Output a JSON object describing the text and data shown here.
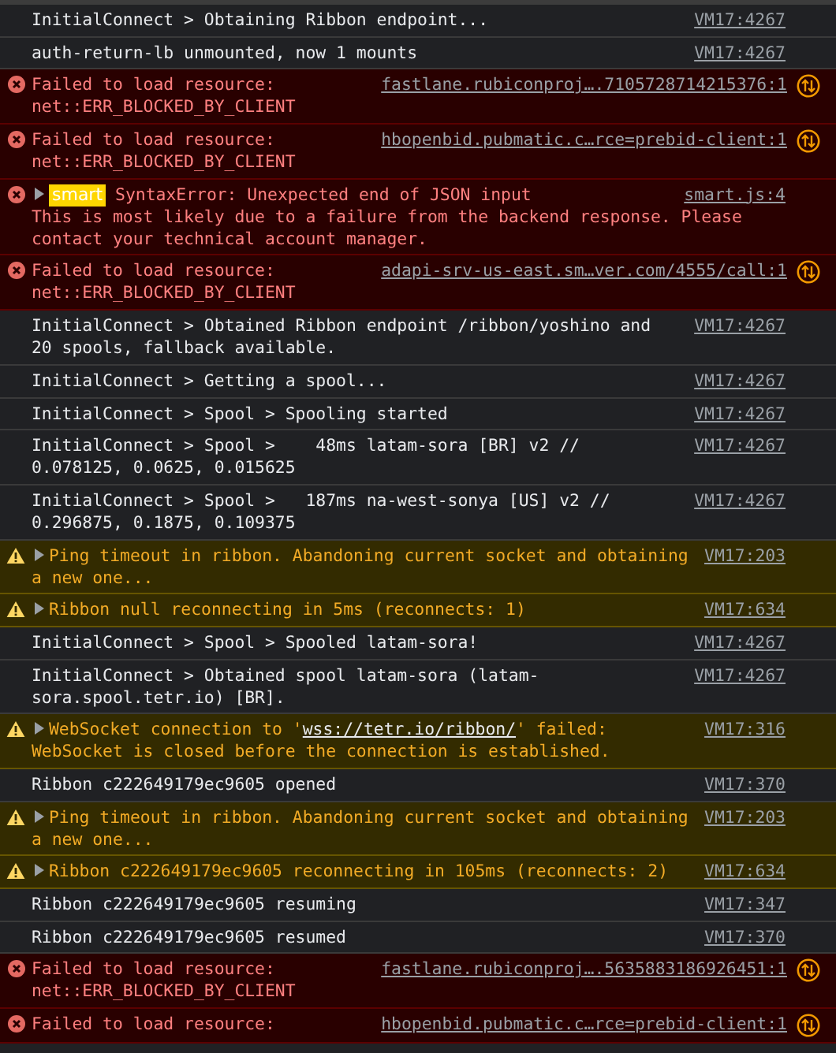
{
  "console": [
    {
      "kind": "info",
      "expandable": false,
      "message": [
        {
          "kind": "text",
          "text": "InitialConnect > Obtaining Ribbon endpoint..."
        }
      ],
      "source": "VM17:4267",
      "network": false
    },
    {
      "kind": "info",
      "expandable": false,
      "message": [
        {
          "kind": "text",
          "text": "auth-return-lb unmounted, now 1 mounts"
        }
      ],
      "source": "VM17:4267",
      "network": false
    },
    {
      "kind": "error",
      "expandable": false,
      "message": [
        {
          "kind": "text",
          "text": "Failed to load resource:\nnet::ERR_BLOCKED_BY_CLIENT"
        }
      ],
      "source": "fastlane.rubiconproj….7105728714215376:1",
      "network": true
    },
    {
      "kind": "error",
      "expandable": false,
      "message": [
        {
          "kind": "text",
          "text": "Failed to load resource:\nnet::ERR_BLOCKED_BY_CLIENT"
        }
      ],
      "source": "hbopenbid.pubmatic.c…rce=prebid-client:1",
      "network": true
    },
    {
      "kind": "error",
      "expandable": true,
      "badge": "smart",
      "message": [
        {
          "kind": "text",
          "text": "SyntaxError: Unexpected end of JSON input"
        }
      ],
      "detail": "This is most likely due to a failure from the backend response. Please\ncontact your technical account manager.",
      "source": "smart.js:4",
      "network": false
    },
    {
      "kind": "error",
      "expandable": false,
      "message": [
        {
          "kind": "text",
          "text": "Failed to load resource:\nnet::ERR_BLOCKED_BY_CLIENT"
        }
      ],
      "source": "adapi-srv-us-east.sm…ver.com/4555/call:1",
      "network": true
    },
    {
      "kind": "info",
      "expandable": false,
      "message": [
        {
          "kind": "text",
          "text": "InitialConnect > Obtained Ribbon endpoint /ribbon/yoshino and\n20 spools, fallback available."
        }
      ],
      "source": "VM17:4267",
      "network": false
    },
    {
      "kind": "info",
      "expandable": false,
      "message": [
        {
          "kind": "text",
          "text": "InitialConnect > Getting a spool..."
        }
      ],
      "source": "VM17:4267",
      "network": false
    },
    {
      "kind": "info",
      "expandable": false,
      "message": [
        {
          "kind": "text",
          "text": "InitialConnect > Spool > Spooling started"
        }
      ],
      "source": "VM17:4267",
      "network": false
    },
    {
      "kind": "info",
      "expandable": false,
      "message": [
        {
          "kind": "text",
          "text": "InitialConnect > Spool >    48ms latam-sora [BR] v2 //\n0.078125, 0.0625, 0.015625"
        }
      ],
      "source": "VM17:4267",
      "network": false
    },
    {
      "kind": "info",
      "expandable": false,
      "message": [
        {
          "kind": "text",
          "text": "InitialConnect > Spool >   187ms na-west-sonya [US] v2 //\n0.296875, 0.1875, 0.109375"
        }
      ],
      "source": "VM17:4267",
      "network": false
    },
    {
      "kind": "warning",
      "expandable": true,
      "message": [
        {
          "kind": "text",
          "text": "Ping timeout in ribbon. Abandoning current socket and obtaining\na new one..."
        }
      ],
      "source": "VM17:203",
      "network": false
    },
    {
      "kind": "warning",
      "expandable": true,
      "message": [
        {
          "kind": "text",
          "text": "Ribbon null reconnecting in 5ms (reconnects: 1)"
        }
      ],
      "source": "VM17:634",
      "network": false
    },
    {
      "kind": "info",
      "expandable": false,
      "message": [
        {
          "kind": "text",
          "text": "InitialConnect > Spool > Spooled latam-sora!"
        }
      ],
      "source": "VM17:4267",
      "network": false
    },
    {
      "kind": "info",
      "expandable": false,
      "message": [
        {
          "kind": "text",
          "text": "InitialConnect > Obtained spool latam-sora (latam-\nsora.spool.tetr.io) [BR]."
        }
      ],
      "source": "VM17:4267",
      "network": false
    },
    {
      "kind": "warning",
      "expandable": true,
      "message": [
        {
          "kind": "text",
          "text": "WebSocket connection to '"
        },
        {
          "kind": "link",
          "text": "wss://tetr.io/ribbon/"
        },
        {
          "kind": "text",
          "text": "' failed:\nWebSocket is closed before the connection is established."
        }
      ],
      "source": "VM17:316",
      "network": false
    },
    {
      "kind": "info",
      "expandable": false,
      "message": [
        {
          "kind": "text",
          "text": "Ribbon c222649179ec9605 opened"
        }
      ],
      "source": "VM17:370",
      "network": false
    },
    {
      "kind": "warning",
      "expandable": true,
      "message": [
        {
          "kind": "text",
          "text": "Ping timeout in ribbon. Abandoning current socket and obtaining\na new one..."
        }
      ],
      "source": "VM17:203",
      "network": false
    },
    {
      "kind": "warning",
      "expandable": true,
      "message": [
        {
          "kind": "text",
          "text": "Ribbon c222649179ec9605 reconnecting in 105ms (reconnects: 2)"
        }
      ],
      "source": "VM17:634",
      "network": false
    },
    {
      "kind": "info",
      "expandable": false,
      "message": [
        {
          "kind": "text",
          "text": "Ribbon c222649179ec9605 resuming"
        }
      ],
      "source": "VM17:347",
      "network": false
    },
    {
      "kind": "info",
      "expandable": false,
      "message": [
        {
          "kind": "text",
          "text": "Ribbon c222649179ec9605 resumed"
        }
      ],
      "source": "VM17:370",
      "network": false
    },
    {
      "kind": "error",
      "expandable": false,
      "message": [
        {
          "kind": "text",
          "text": "Failed to load resource:\nnet::ERR_BLOCKED_BY_CLIENT"
        }
      ],
      "source": "fastlane.rubiconproj….5635883186926451:1",
      "network": true
    },
    {
      "kind": "error",
      "expandable": false,
      "message": [
        {
          "kind": "text",
          "text": "Failed to load resource:"
        }
      ],
      "source": "hbopenbid.pubmatic.c…rce=prebid-client:1",
      "network": true
    }
  ]
}
